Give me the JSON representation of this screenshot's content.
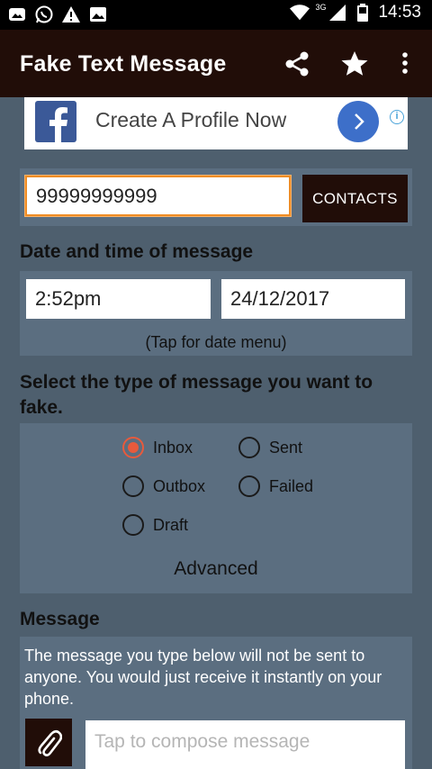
{
  "status_bar": {
    "time": "14:53",
    "network": "3G",
    "icons": [
      "photo-icon",
      "whatsapp-icon",
      "warning-icon",
      "image-icon",
      "wifi-icon",
      "signal-icon",
      "battery-icon"
    ]
  },
  "app_bar": {
    "title": "Fake Text Message",
    "actions": [
      "share-icon",
      "star-icon",
      "overflow-menu-icon"
    ]
  },
  "ad": {
    "logo_letter": "f",
    "text": "Create A Profile Now",
    "info": "i"
  },
  "phone": {
    "value": "99999999999",
    "contacts_label": "CONTACTS"
  },
  "date_time": {
    "heading": "Date and time of message",
    "time": "2:52pm",
    "date": "24/12/2017",
    "hint": "(Tap for date menu)"
  },
  "message_type": {
    "heading": "Select the type of message you want to fake.",
    "options": [
      {
        "label": "Inbox",
        "checked": true
      },
      {
        "label": "Sent",
        "checked": false
      },
      {
        "label": "Outbox",
        "checked": false
      },
      {
        "label": "Failed",
        "checked": false
      },
      {
        "label": "Draft",
        "checked": false
      }
    ],
    "advanced_label": "Advanced"
  },
  "message": {
    "heading": "Message",
    "note": "The message you type below will not be sent to anyone. You would just receive it instantly on your phone.",
    "placeholder": "Tap to compose message"
  },
  "colors": {
    "app_bar": "#210d08",
    "panel": "#5b6e80",
    "background": "#4e5f6e",
    "accent": "#e85a3c",
    "focus": "#f08d24"
  }
}
